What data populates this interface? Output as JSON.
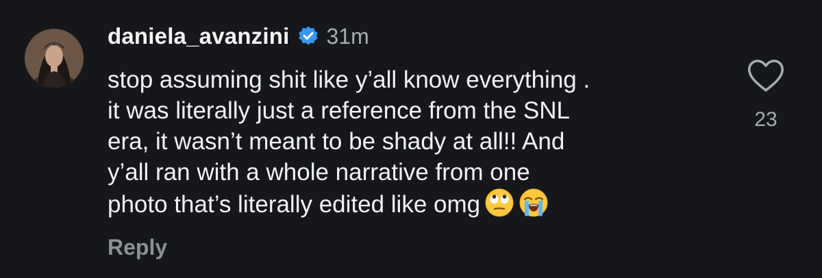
{
  "comment": {
    "username": "daniela_avanzini",
    "verified": true,
    "timestamp": "31m",
    "text_lines": [
      "stop assuming shit like y’all know everything .",
      "it was literally just a reference from the SNL",
      "era, it wasn’t meant to be shady at all!! And",
      "y’all ran with a whole narrative from one",
      "photo that’s literally edited like omg"
    ],
    "emojis": [
      "face-with-rolling-eyes-emoji",
      "loudly-crying-face-emoji"
    ],
    "reply_label": "Reply",
    "like_count": "23",
    "like_icon": "heart-outline-icon"
  },
  "colors": {
    "background": "#15171b",
    "text": "#f2f3f5",
    "muted": "#a8abb1",
    "verified_badge": "#3897f0"
  }
}
